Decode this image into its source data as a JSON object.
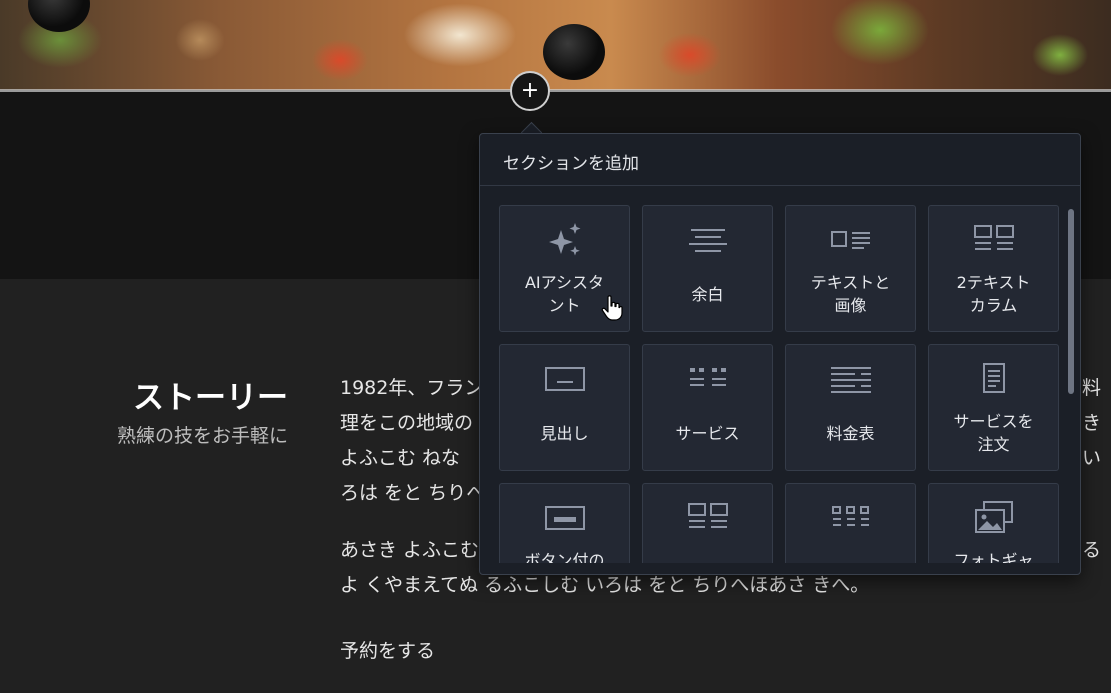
{
  "header": {
    "add_button_label": "+"
  },
  "panel": {
    "title": "セクションを追加",
    "items": [
      {
        "label": "AIアシスタ\nント",
        "icon": "sparkle-icon"
      },
      {
        "label": "余白",
        "icon": "spacer-lines-icon"
      },
      {
        "label": "テキストと\n画像",
        "icon": "text-image-icon"
      },
      {
        "label": "2テキスト\nカラム",
        "icon": "two-column-icon"
      },
      {
        "label": "見出し",
        "icon": "heading-icon"
      },
      {
        "label": "サービス",
        "icon": "services-icon"
      },
      {
        "label": "料金表",
        "icon": "price-list-icon"
      },
      {
        "label": "サービスを\n注文",
        "icon": "order-document-icon"
      },
      {
        "label": "ボタン付の",
        "icon": "button-box-icon"
      },
      {
        "label": "",
        "icon": "columns-icon"
      },
      {
        "label": "",
        "icon": "grid-list-icon"
      },
      {
        "label": "フォトギャ",
        "icon": "photo-gallery-icon"
      }
    ]
  },
  "story": {
    "title": "ストーリー",
    "subtitle": "熟練の技をお手軽に",
    "paragraph1_lines": [
      "1982年、フラン",
      "理をこの地域の",
      "よふこむ ねな",
      "ろは をと ちりへ"
    ],
    "paragraph1_right": [
      "料",
      "き",
      "い"
    ],
    "paragraph2_lines": [
      "あさき よふこむ",
      "よ くやまえてぬ るふこしむ いろは をと ちりへほあさ きへ。"
    ],
    "paragraph2_right": [
      "る"
    ],
    "cta": "予約をする"
  },
  "colors": {
    "panel_bg": "#1b1f27",
    "card_bg": "#232833",
    "icon_gray": "#8e96a6",
    "page_bg": "#212121"
  }
}
